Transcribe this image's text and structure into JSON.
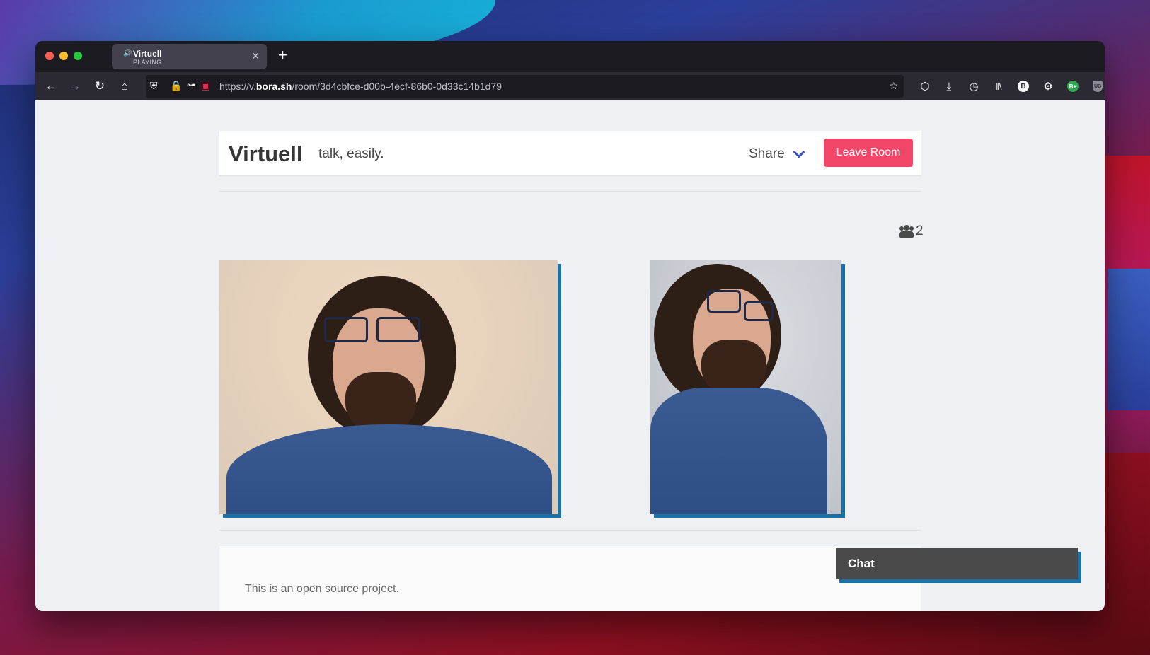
{
  "browser": {
    "tab": {
      "title": "Virtuell",
      "subtitle": "PLAYING"
    },
    "url": {
      "prefix": "https://v.",
      "domain": "bora.sh",
      "path": "/room/3d4cbfce-d00b-4ecf-86b0-0d33c14b1d79"
    },
    "toolbar": {
      "ext_b_label": "B",
      "ext_bplus_label": "B+",
      "ext_ub_label": "UB"
    }
  },
  "app": {
    "brand": "Virtuell",
    "tagline": "talk, easily.",
    "share_label": "Share",
    "leave_label": "Leave Room",
    "participant_count": "2",
    "footer_text": "This is an open source project.",
    "chat_label": "Chat"
  },
  "colors": {
    "leave_button": "#f14668",
    "video_shadow": "#1672a8",
    "share_chevron": "#3e56c4"
  },
  "icons": {
    "participants": "users-icon",
    "share": "chevron-down-icon"
  }
}
